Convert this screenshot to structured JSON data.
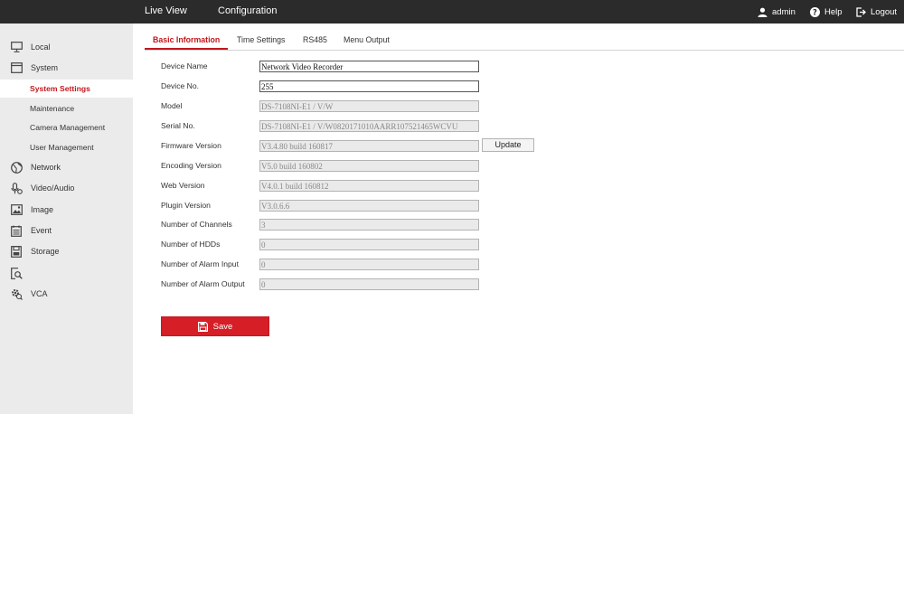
{
  "header": {
    "nav": [
      "Live View",
      "Configuration"
    ],
    "user": "admin",
    "help": "Help",
    "logout": "Logout"
  },
  "sidebar": {
    "items": [
      {
        "label": "Local",
        "icon": "monitor-icon"
      },
      {
        "label": "System",
        "icon": "window-icon"
      },
      {
        "label": "Network",
        "icon": "globe-icon"
      },
      {
        "label": "Video/Audio",
        "icon": "microphone-icon"
      },
      {
        "label": "Image",
        "icon": "picture-icon"
      },
      {
        "label": "Event",
        "icon": "calendar-icon"
      },
      {
        "label": "Storage",
        "icon": "storage-icon"
      },
      {
        "label": "",
        "icon": "search-document-icon"
      },
      {
        "label": "VCA",
        "icon": "gear-search-icon"
      }
    ],
    "system_sub": [
      "System Settings",
      "Maintenance",
      "Camera Management",
      "User Management"
    ]
  },
  "tabs": [
    "Basic Information",
    "Time Settings",
    "RS485",
    "Menu Output"
  ],
  "form": {
    "fields": [
      {
        "label": "Device Name",
        "value": "Network Video Recorder"
      },
      {
        "label": "Device No.",
        "value": "255"
      },
      {
        "label": "Model",
        "value": "DS-7108NI-E1 / V/W"
      },
      {
        "label": "Serial No.",
        "value": "DS-7108NI-E1 / V/W0820171010AARR107521465WCVU"
      },
      {
        "label": "Firmware Version",
        "value": "V3.4.80 build 160817"
      },
      {
        "label": "Encoding Version",
        "value": "V5.0 build 160802"
      },
      {
        "label": "Web Version",
        "value": "V4.0.1 build 160812"
      },
      {
        "label": "Plugin Version",
        "value": "V3.0.6.6"
      },
      {
        "label": "Number of Channels",
        "value": "3"
      },
      {
        "label": "Number of HDDs",
        "value": "0"
      },
      {
        "label": "Number of Alarm Input",
        "value": "0"
      },
      {
        "label": "Number of Alarm Output",
        "value": "0"
      }
    ],
    "update_label": "Update",
    "save_label": "Save"
  },
  "colors": {
    "accent": "#c4161c",
    "topbar": "#2b2b2b",
    "sidebar": "#ebebeb",
    "save_button": "#d51e26"
  }
}
